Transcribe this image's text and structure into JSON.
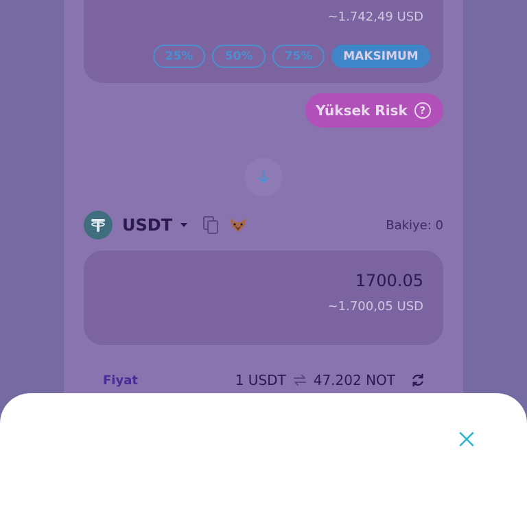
{
  "from_panel": {
    "usd_value": "~1.742,49 USD",
    "percent_buttons": [
      "25%",
      "50%",
      "75%",
      "MAKSIMUM"
    ]
  },
  "risk": {
    "label": "Yüksek Risk",
    "help_glyph": "?"
  },
  "swap_button": {
    "icon": "arrow-down-icon"
  },
  "to_token": {
    "symbol": "USDT",
    "logo_glyph": "₮",
    "balance": "Bakiye: 0",
    "amount": "1700.05",
    "usd_value": "~1.700,05 USD"
  },
  "price": {
    "label": "Fiyat",
    "left": "1 USDT",
    "right": "47.202 NOT"
  },
  "colors": {
    "accent_blue": "#4b8fd0",
    "risk_magenta": "#b050b8",
    "close_teal": "#2ab8c8",
    "price_label": "#4a2c96"
  }
}
